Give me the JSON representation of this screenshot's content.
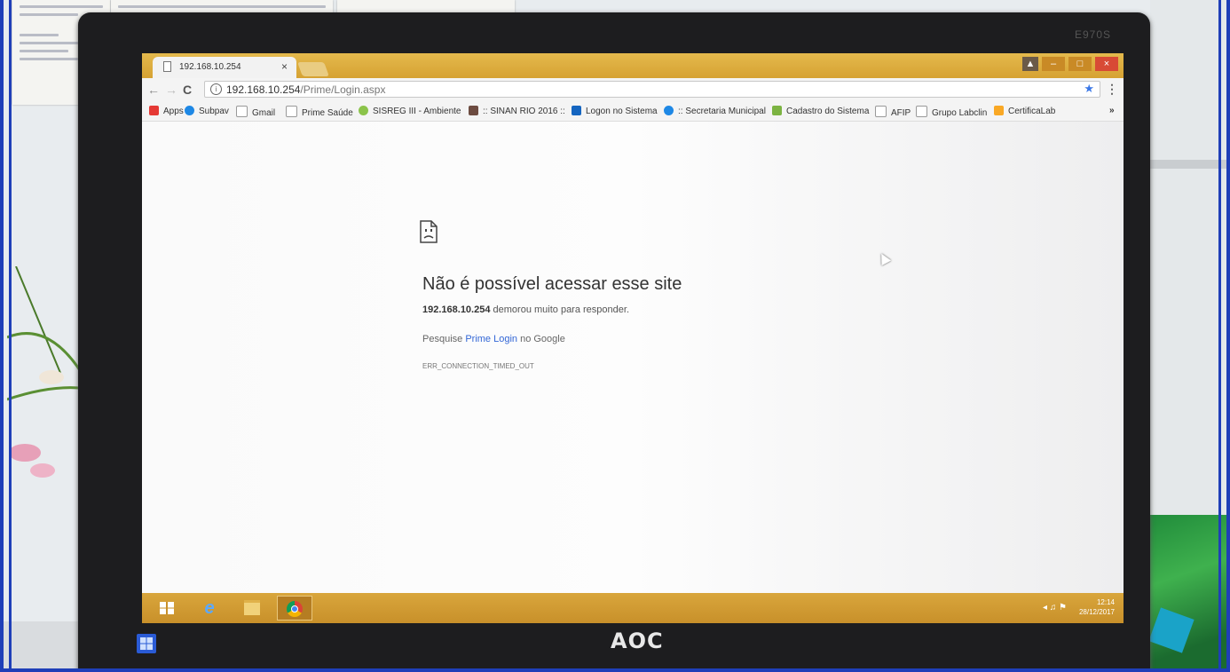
{
  "tab": {
    "title": "192.168.10.254",
    "close": "×"
  },
  "window_controls": {
    "profile": "▲",
    "minimize": "–",
    "maximize": "□",
    "close": "×"
  },
  "nav": {
    "back": "←",
    "forward": "→",
    "reload": "C"
  },
  "omnibox": {
    "host": "192.168.10.254",
    "path": "/Prime/Login.aspx",
    "info": "i",
    "star": "★"
  },
  "menu": "⋮",
  "bookmarks": [
    {
      "label": "Apps",
      "color": "#e53935"
    },
    {
      "label": "Subpav",
      "color": "#1e88e5"
    },
    {
      "label": "Gmail",
      "color": "#ffffff"
    },
    {
      "label": "Prime Saúde",
      "color": "#ffffff"
    },
    {
      "label": "SISREG III - Ambiente",
      "color": "#8bc34a"
    },
    {
      "label": ":: SINAN RIO 2016 ::",
      "color": "#6d4c41"
    },
    {
      "label": "Logon no Sistema",
      "color": "#1565c0"
    },
    {
      "label": ":: Secretaria Municipal",
      "color": "#1e88e5"
    },
    {
      "label": "Cadastro do Sistema",
      "color": "#7cb342"
    },
    {
      "label": "AFIP",
      "color": "#ffffff"
    },
    {
      "label": "Grupo Labclin",
      "color": "#ffffff"
    },
    {
      "label": "CertificaLab",
      "color": "#f9a825"
    }
  ],
  "bookmarks_overflow": "»",
  "error": {
    "title": "Não é possível acessar esse site",
    "host": "192.168.10.254",
    "message": " demorou muito para responder.",
    "search_prefix": "Pesquise ",
    "search_link": "Prime Login",
    "search_suffix": " no Google",
    "code": "ERR_CONNECTION_TIMED_OUT"
  },
  "monitor": {
    "brand": "AOC",
    "model": "E970S"
  },
  "taskbar": {
    "ie_label": "e",
    "clock_time": "12:14",
    "clock_date": "28/12/2017"
  }
}
